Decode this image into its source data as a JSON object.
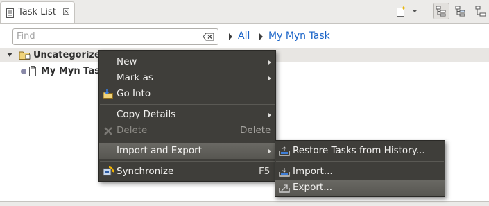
{
  "view": {
    "tab_title": "Task List",
    "close_glyph": "☒"
  },
  "toolbar": {
    "icons": [
      "new-task-icon",
      "view-menu-chevron-icon",
      "categorized-view-icon",
      "scheduled-view-icon",
      "more-views-icon"
    ]
  },
  "filter": {
    "placeholder": "Find",
    "breadcrumbs": [
      "All",
      "My Myn Task"
    ]
  },
  "tree": {
    "category": "Uncategorized",
    "task": "My Myn Task"
  },
  "context_menu": {
    "items": [
      {
        "label": "New",
        "submenu": true
      },
      {
        "label": "Mark as",
        "submenu": true
      },
      {
        "label": "Go Into",
        "icon": "go-into-icon"
      },
      {
        "label": "Copy Details",
        "submenu": true
      },
      {
        "label": "Delete",
        "accel": "Delete",
        "disabled": true,
        "icon": "delete-icon"
      },
      {
        "label": "Import and Export",
        "submenu": true,
        "highlighted": true
      },
      {
        "label": "Synchronize",
        "accel": "F5",
        "icon": "synchronize-icon"
      }
    ]
  },
  "submenu": {
    "items": [
      {
        "label": "Restore Tasks from History...",
        "icon": "restore-tasks-icon"
      },
      {
        "label": "Import...",
        "icon": "import-icon"
      },
      {
        "label": "Export...",
        "icon": "export-icon",
        "highlighted": true
      }
    ]
  },
  "colors": {
    "menu_bg": "#3f3e3a",
    "menu_highlight": "#62615c",
    "link": "#1a64c8"
  }
}
